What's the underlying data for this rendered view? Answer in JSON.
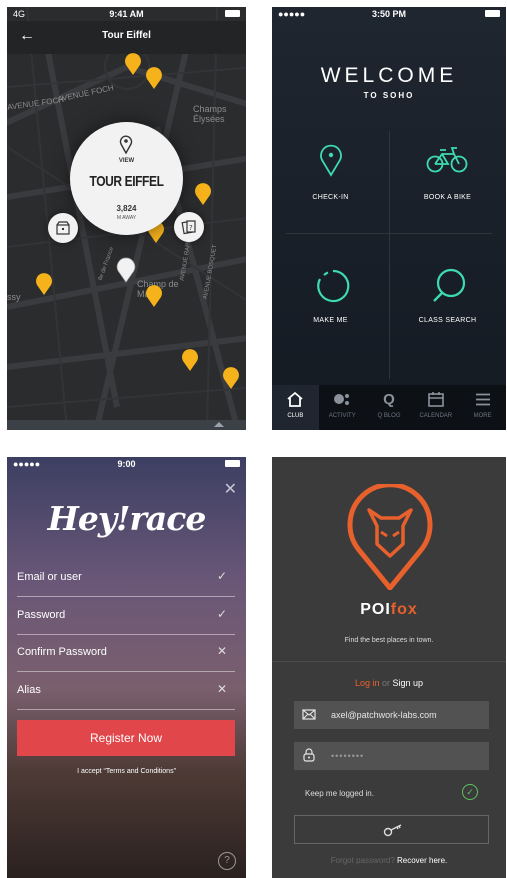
{
  "map": {
    "carrier": "4G",
    "time": "9:41 AM",
    "title": "Tour Eiffel",
    "labels": [
      "AVENUE FOCH",
      "AVENUE FOCH",
      "Champs Élysées",
      "Champ de Mars",
      "AVENUE RAPP",
      "AVENUE BOSQUET",
      "Ile de France",
      "ssy"
    ],
    "place": {
      "view_label": "VIEW",
      "name": "TOUR EIFFEL",
      "count": "3,824",
      "away": "M AWAY"
    },
    "pin_color": "#f5b21b"
  },
  "soho": {
    "time": "3:50 PM",
    "welcome": "WELCOME",
    "subtitle": "TO SOHO",
    "accent": "#3ddbb0",
    "tiles": [
      "CHECK-IN",
      "BOOK A BIKE",
      "MAKE ME",
      "CLASS SEARCH"
    ],
    "tabs": [
      {
        "label": "CLUB",
        "icon": "home-icon"
      },
      {
        "label": "ACTIVITY",
        "icon": "activity-icon"
      },
      {
        "label": "Q BLOG",
        "icon": "q-icon",
        "glyph": "Q"
      },
      {
        "label": "CALENDAR",
        "icon": "calendar-icon"
      },
      {
        "label": "MORE",
        "icon": "menu-icon"
      }
    ]
  },
  "heyrace": {
    "time": "9:00",
    "logo": "Hey!race",
    "fields": [
      {
        "label": "Email or user",
        "mark": "✓"
      },
      {
        "label": "Password",
        "mark": "✓"
      },
      {
        "label": "Confirm Password",
        "mark": "✕"
      },
      {
        "label": "Alias",
        "mark": "✕"
      }
    ],
    "close": "✕",
    "button": "Register Now",
    "terms": "I accept “Terms and Conditions”",
    "help": "?"
  },
  "poifox": {
    "brand_poi": "POI",
    "brand_fox": "fox",
    "tagline": "Find the best places in town.",
    "login": "Log in",
    "or": "or",
    "signup": "Sign up",
    "email": "axel@patchwork-labs.com",
    "password": "••••••••",
    "keep": "Keep me logged in.",
    "forgot": "Forgot password?",
    "recover": "Recover here.",
    "orange": "#e8612c"
  }
}
